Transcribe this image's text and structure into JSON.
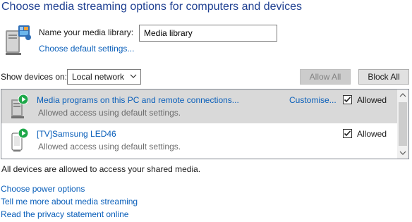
{
  "title": "Choose media streaming options for computers and devices",
  "library": {
    "name_label": "Name your media library:",
    "name_value": "Media library",
    "defaults_link": "Choose default settings..."
  },
  "filter": {
    "show_label": "Show devices on:",
    "selected": "Local network",
    "allow_all": "Allow All",
    "block_all": "Block All"
  },
  "devices": [
    {
      "name": "Media programs on this PC and remote connections...",
      "subtitle": "Allowed access using default settings.",
      "customise": "Customise...",
      "allowed_label": "Allowed",
      "allowed": true,
      "selected": true
    },
    {
      "name": "[TV]Samsung LED46",
      "subtitle": "Allowed access using default settings.",
      "allowed_label": "Allowed",
      "allowed": true,
      "selected": false
    }
  ],
  "status": "All devices are allowed to access your shared media.",
  "links": [
    "Choose power options",
    "Tell me more about media streaming",
    "Read the privacy statement online"
  ],
  "colors": {
    "title": "#1e3f91",
    "link": "#0a5fba",
    "selected_row": "#d9d9d9",
    "play_badge": "#1fa84a"
  },
  "icons": [
    "media-library-icon",
    "pc-media-icon",
    "tv-device-icon",
    "play-badge-icon",
    "checkmark-icon",
    "chevron-down-icon",
    "scroll-up-icon",
    "scroll-down-icon"
  ]
}
